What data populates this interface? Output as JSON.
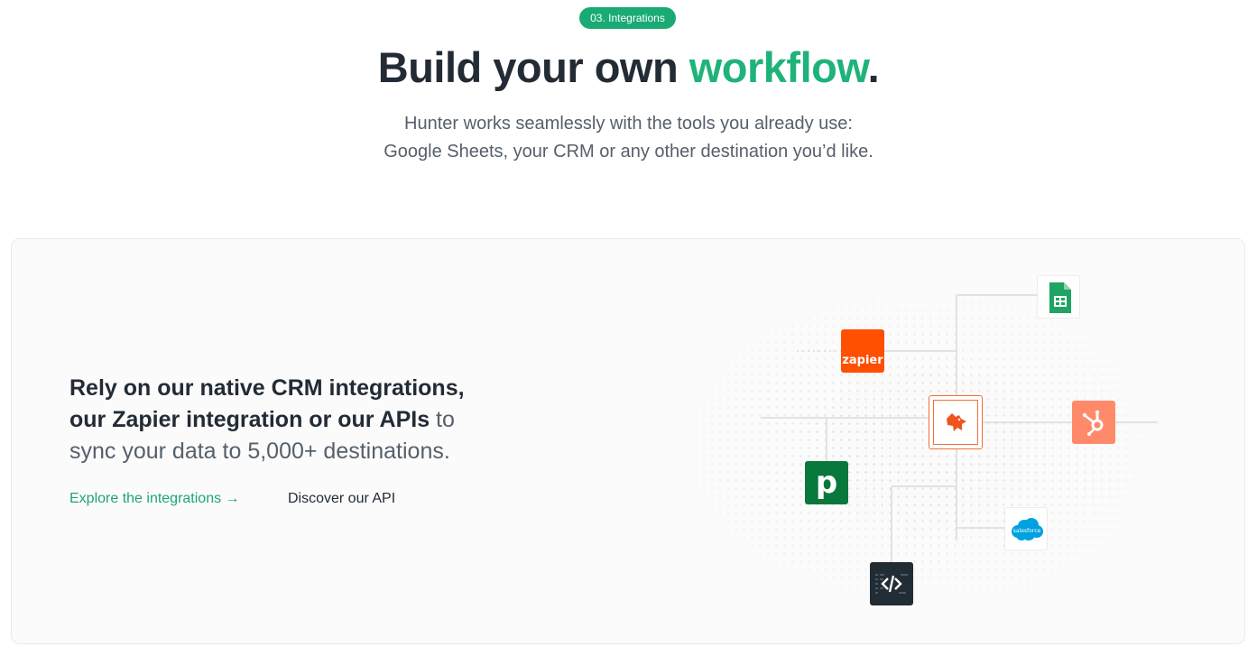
{
  "header": {
    "badge": "03. Integrations",
    "title_main": "Build your own ",
    "title_accent": "workflow",
    "title_end": ".",
    "subtitle_line1": "Hunter works seamlessly with the tools you already use:",
    "subtitle_line2": "Google Sheets, your CRM or any other destination you’d like."
  },
  "card": {
    "headline_bold1": "Rely on our native CRM integrations,",
    "headline_bold2": "our Zapier integration or our APIs",
    "headline_rest1": " to",
    "headline_rest2": "sync your data to 5,000+ destinations.",
    "explore_link": "Explore the integrations →",
    "api_link": "Discover our API"
  },
  "integrations": {
    "zapier_label": "zapier",
    "pipedrive_label": "p",
    "salesforce_label": "salesforce",
    "icons": [
      "google-sheets-icon",
      "zapier-icon",
      "hunter-fox-icon",
      "hubspot-icon",
      "pipedrive-icon",
      "salesforce-icon",
      "code-api-icon"
    ]
  },
  "colors": {
    "accent": "#1fb37a",
    "text": "#232b35",
    "muted": "#55606b",
    "zapier": "#ff4f00",
    "hunter": "#f07038",
    "hubspot": "#ff8a6a",
    "pipedrive": "#08783c",
    "salesforce": "#00a1e0",
    "api": "#222c35"
  }
}
